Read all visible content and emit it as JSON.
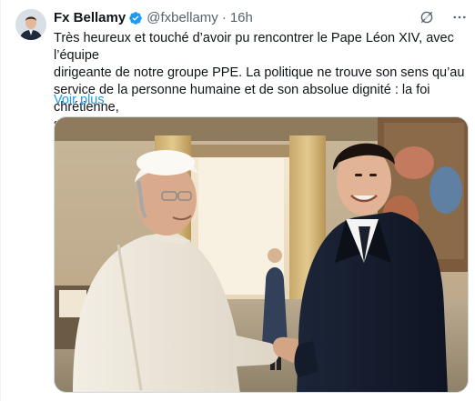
{
  "author": {
    "display_name": "Fx Bellamy",
    "handle": "@fxbellamy",
    "separator": "·",
    "time": "16h"
  },
  "icons": {
    "verified": "verified-badge-icon",
    "grok": "grok-icon",
    "more": "more-options-icon"
  },
  "tweet": {
    "text": "Très heureux et touché d’avoir pu rencontrer le Pape Léon XIV, avec l’équipe\ndirigeante de notre groupe PPE. La politique ne trouve son sens qu’au\nservice de la personne humaine et de son absolue dignité : la foi chrétienne,\nsi étroitement liée à la vocation de la France et de",
    "show_more": "Voir plus"
  },
  "colors": {
    "link": "#1d9bf0",
    "text": "#0f1419",
    "muted": "#536471",
    "verified": "#1d9bf0"
  }
}
